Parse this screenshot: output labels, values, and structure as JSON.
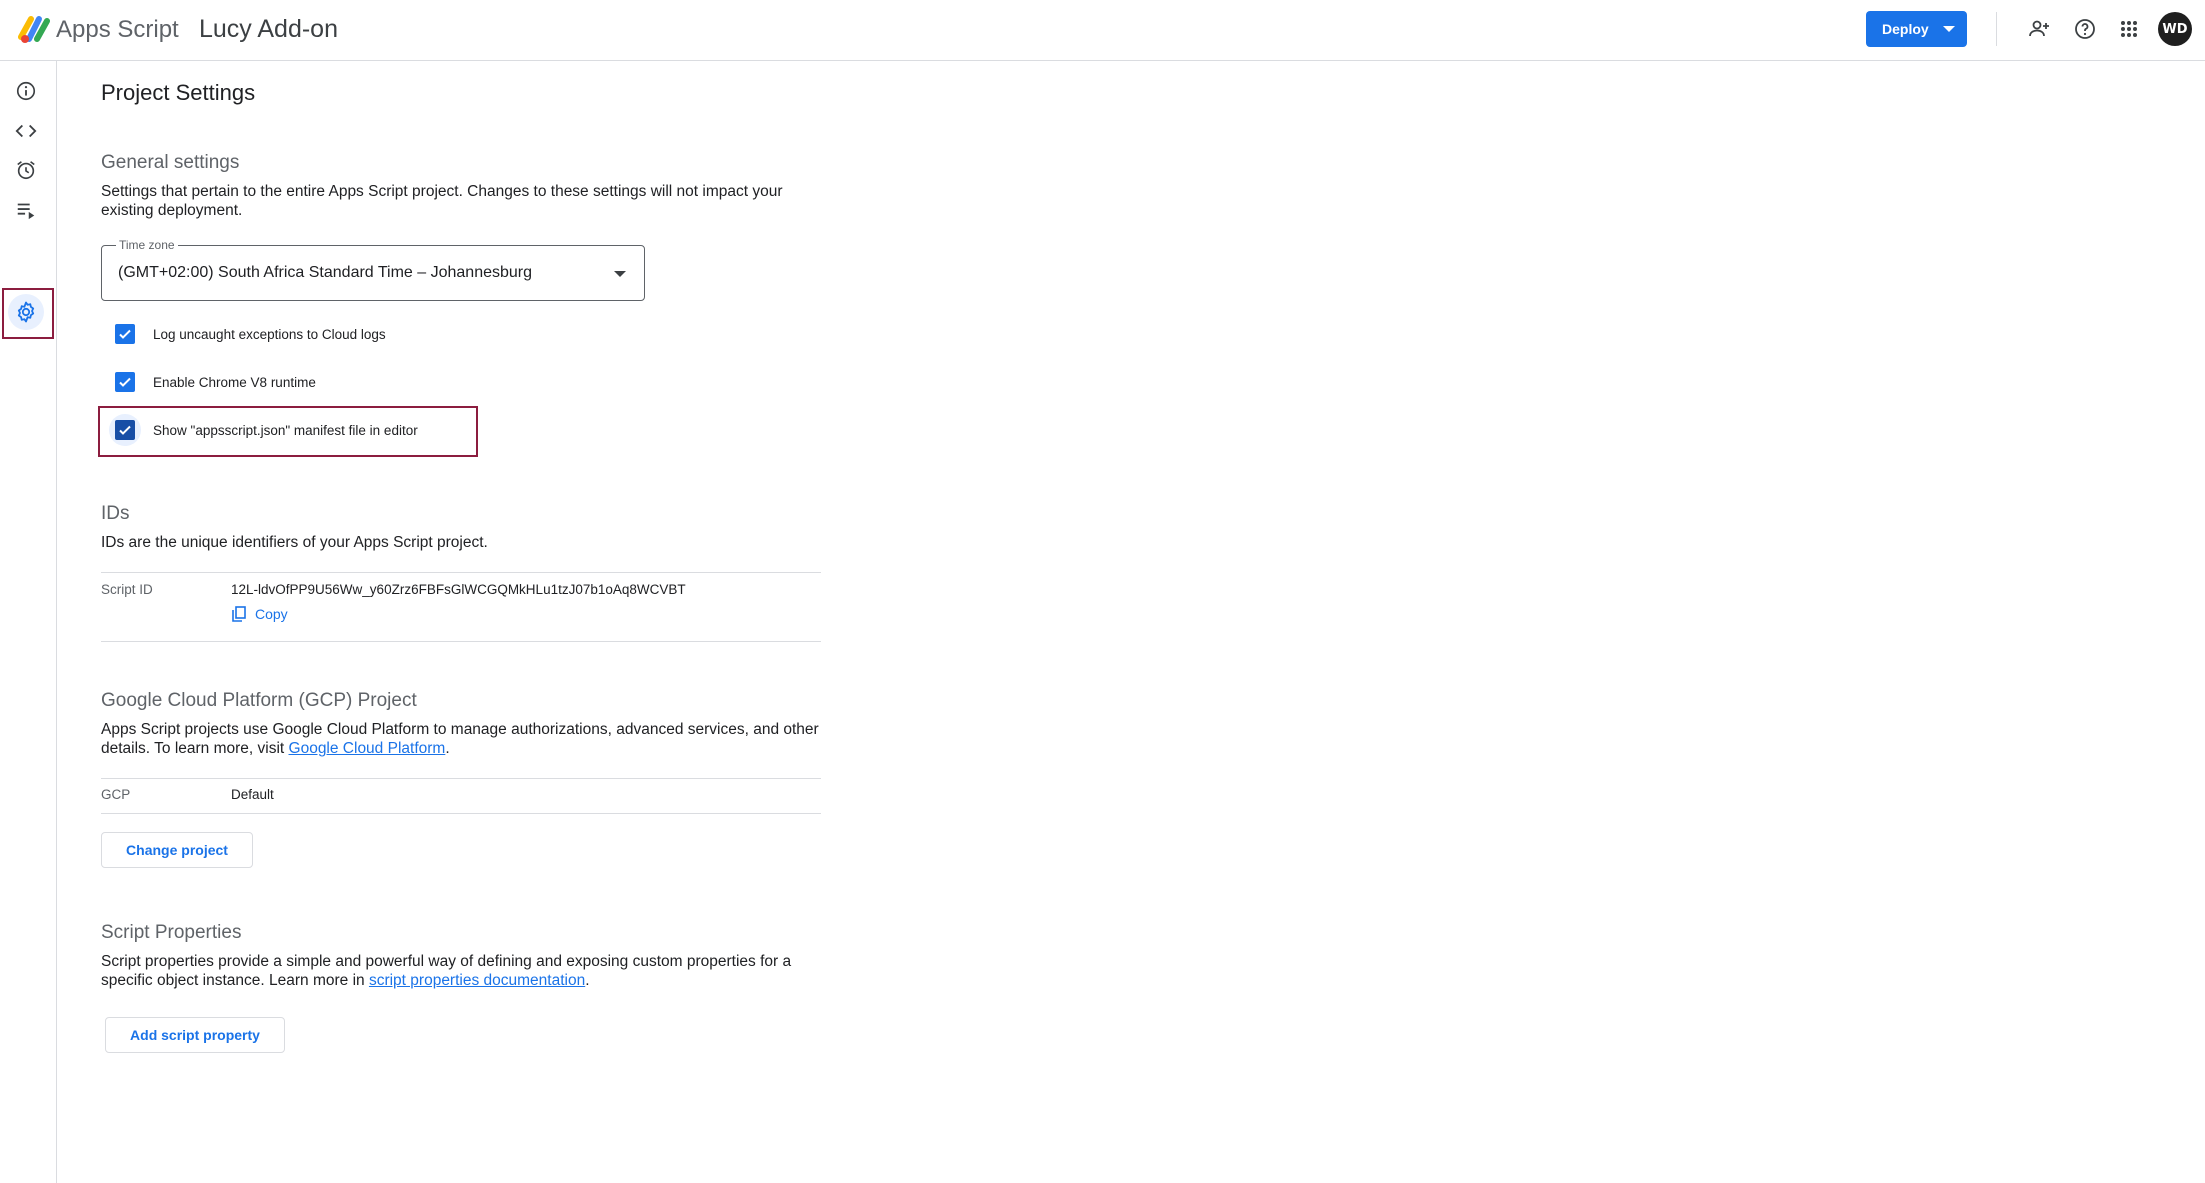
{
  "header": {
    "brand": "Apps Script",
    "project_name": "Lucy Add-on",
    "deploy_label": "Deploy",
    "avatar_initials": "WD"
  },
  "rail": {
    "items": [
      {
        "name": "overview",
        "icon": "info-icon"
      },
      {
        "name": "editor",
        "icon": "code-icon"
      },
      {
        "name": "triggers",
        "icon": "alarm-icon"
      },
      {
        "name": "executions",
        "icon": "executions-icon"
      },
      {
        "name": "project-settings",
        "icon": "gear-icon",
        "active": true
      }
    ]
  },
  "page": {
    "title": "Project Settings"
  },
  "general": {
    "title": "General settings",
    "description": "Settings that pertain to the entire Apps Script project. Changes to these settings will not impact your existing deployment.",
    "timezone_label": "Time zone",
    "timezone_value": "(GMT+02:00) South Africa Standard Time – Johannesburg",
    "checkboxes": [
      {
        "label": "Log uncaught exceptions to Cloud logs",
        "checked": true
      },
      {
        "label": "Enable Chrome V8 runtime",
        "checked": true
      },
      {
        "label": "Show \"appsscript.json\" manifest file in editor",
        "checked": true
      }
    ]
  },
  "ids": {
    "title": "IDs",
    "description": "IDs are the unique identifiers of your Apps Script project.",
    "script_id_label": "Script ID",
    "script_id_value": "12L-ldvOfPP9U56Ww_y60Zrz6FBFsGlWCGQMkHLu1tzJ07b1oAq8WCVBT",
    "copy_label": "Copy"
  },
  "gcp": {
    "title": "Google Cloud Platform (GCP) Project",
    "description_prefix": "Apps Script projects use Google Cloud Platform to manage authorizations, advanced services, and other details. To learn more, visit ",
    "link_text": "Google Cloud Platform",
    "description_suffix": ".",
    "key": "GCP",
    "value": "Default",
    "button": "Change project"
  },
  "script_props": {
    "title": "Script Properties",
    "description_prefix": "Script properties provide a simple and powerful way of defining and exposing custom properties for a specific object instance. Learn more in ",
    "link_text": "script properties documentation",
    "description_suffix": ".",
    "button": "Add script property"
  },
  "colors": {
    "accent": "#1a73e8",
    "highlight_box": "#8c1d3f"
  }
}
